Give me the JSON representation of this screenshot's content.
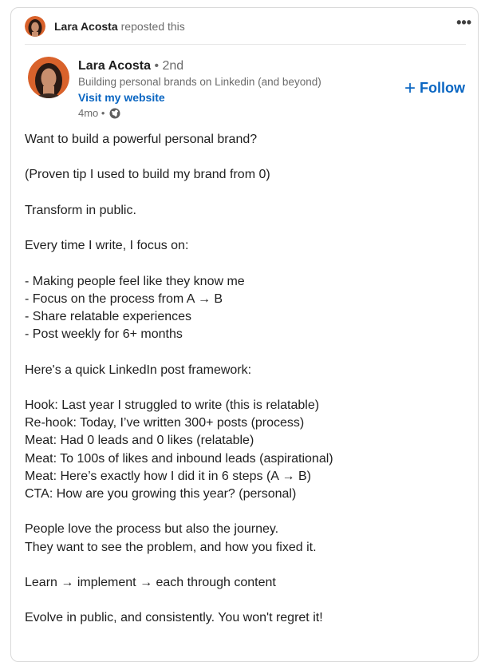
{
  "repost": {
    "name": "Lara Acosta",
    "suffix": "reposted this",
    "more_label": "•••"
  },
  "author": {
    "name": "Lara Acosta",
    "degree": " • 2nd",
    "headline": "Building personal brands on Linkedin (and beyond)",
    "website_label": "Visit my website",
    "age": "4mo •",
    "visibility_icon": "globe-icon"
  },
  "follow": {
    "plus": "+",
    "label": "Follow"
  },
  "post": {
    "lines": [
      "Want to build a powerful personal brand?",
      "",
      "(Proven tip I used to build my brand from 0)",
      "",
      "Transform in public.",
      "",
      "Every time I write, I focus on:",
      "",
      "- Making people feel like they know me",
      "- Focus on the process from A → B",
      "- Share relatable experiences",
      "- Post weekly for 6+ months",
      "",
      "Here's a quick LinkedIn post framework:",
      "",
      "Hook: Last year I struggled to write (this is relatable)",
      "Re-hook: Today, I’ve written 300+ posts (process)",
      "Meat: Had 0 leads and 0 likes (relatable)",
      "Meat: To 100s of likes and inbound leads (aspirational)",
      "Meat: Here’s exactly how I did it in 6 steps (A → B)",
      "CTA: How are you growing this year? (personal)",
      "",
      "People love the process but also the journey.",
      "They want to see the problem, and how you fixed it.",
      "",
      "Learn → implement → each through content",
      "",
      "Evolve in public, and consistently. You won't regret it!"
    ]
  },
  "colors": {
    "link": "#0a66c2",
    "text": "#1f1f1f",
    "muted": "#6b6b6b",
    "avatar_background": "#d9622b"
  }
}
